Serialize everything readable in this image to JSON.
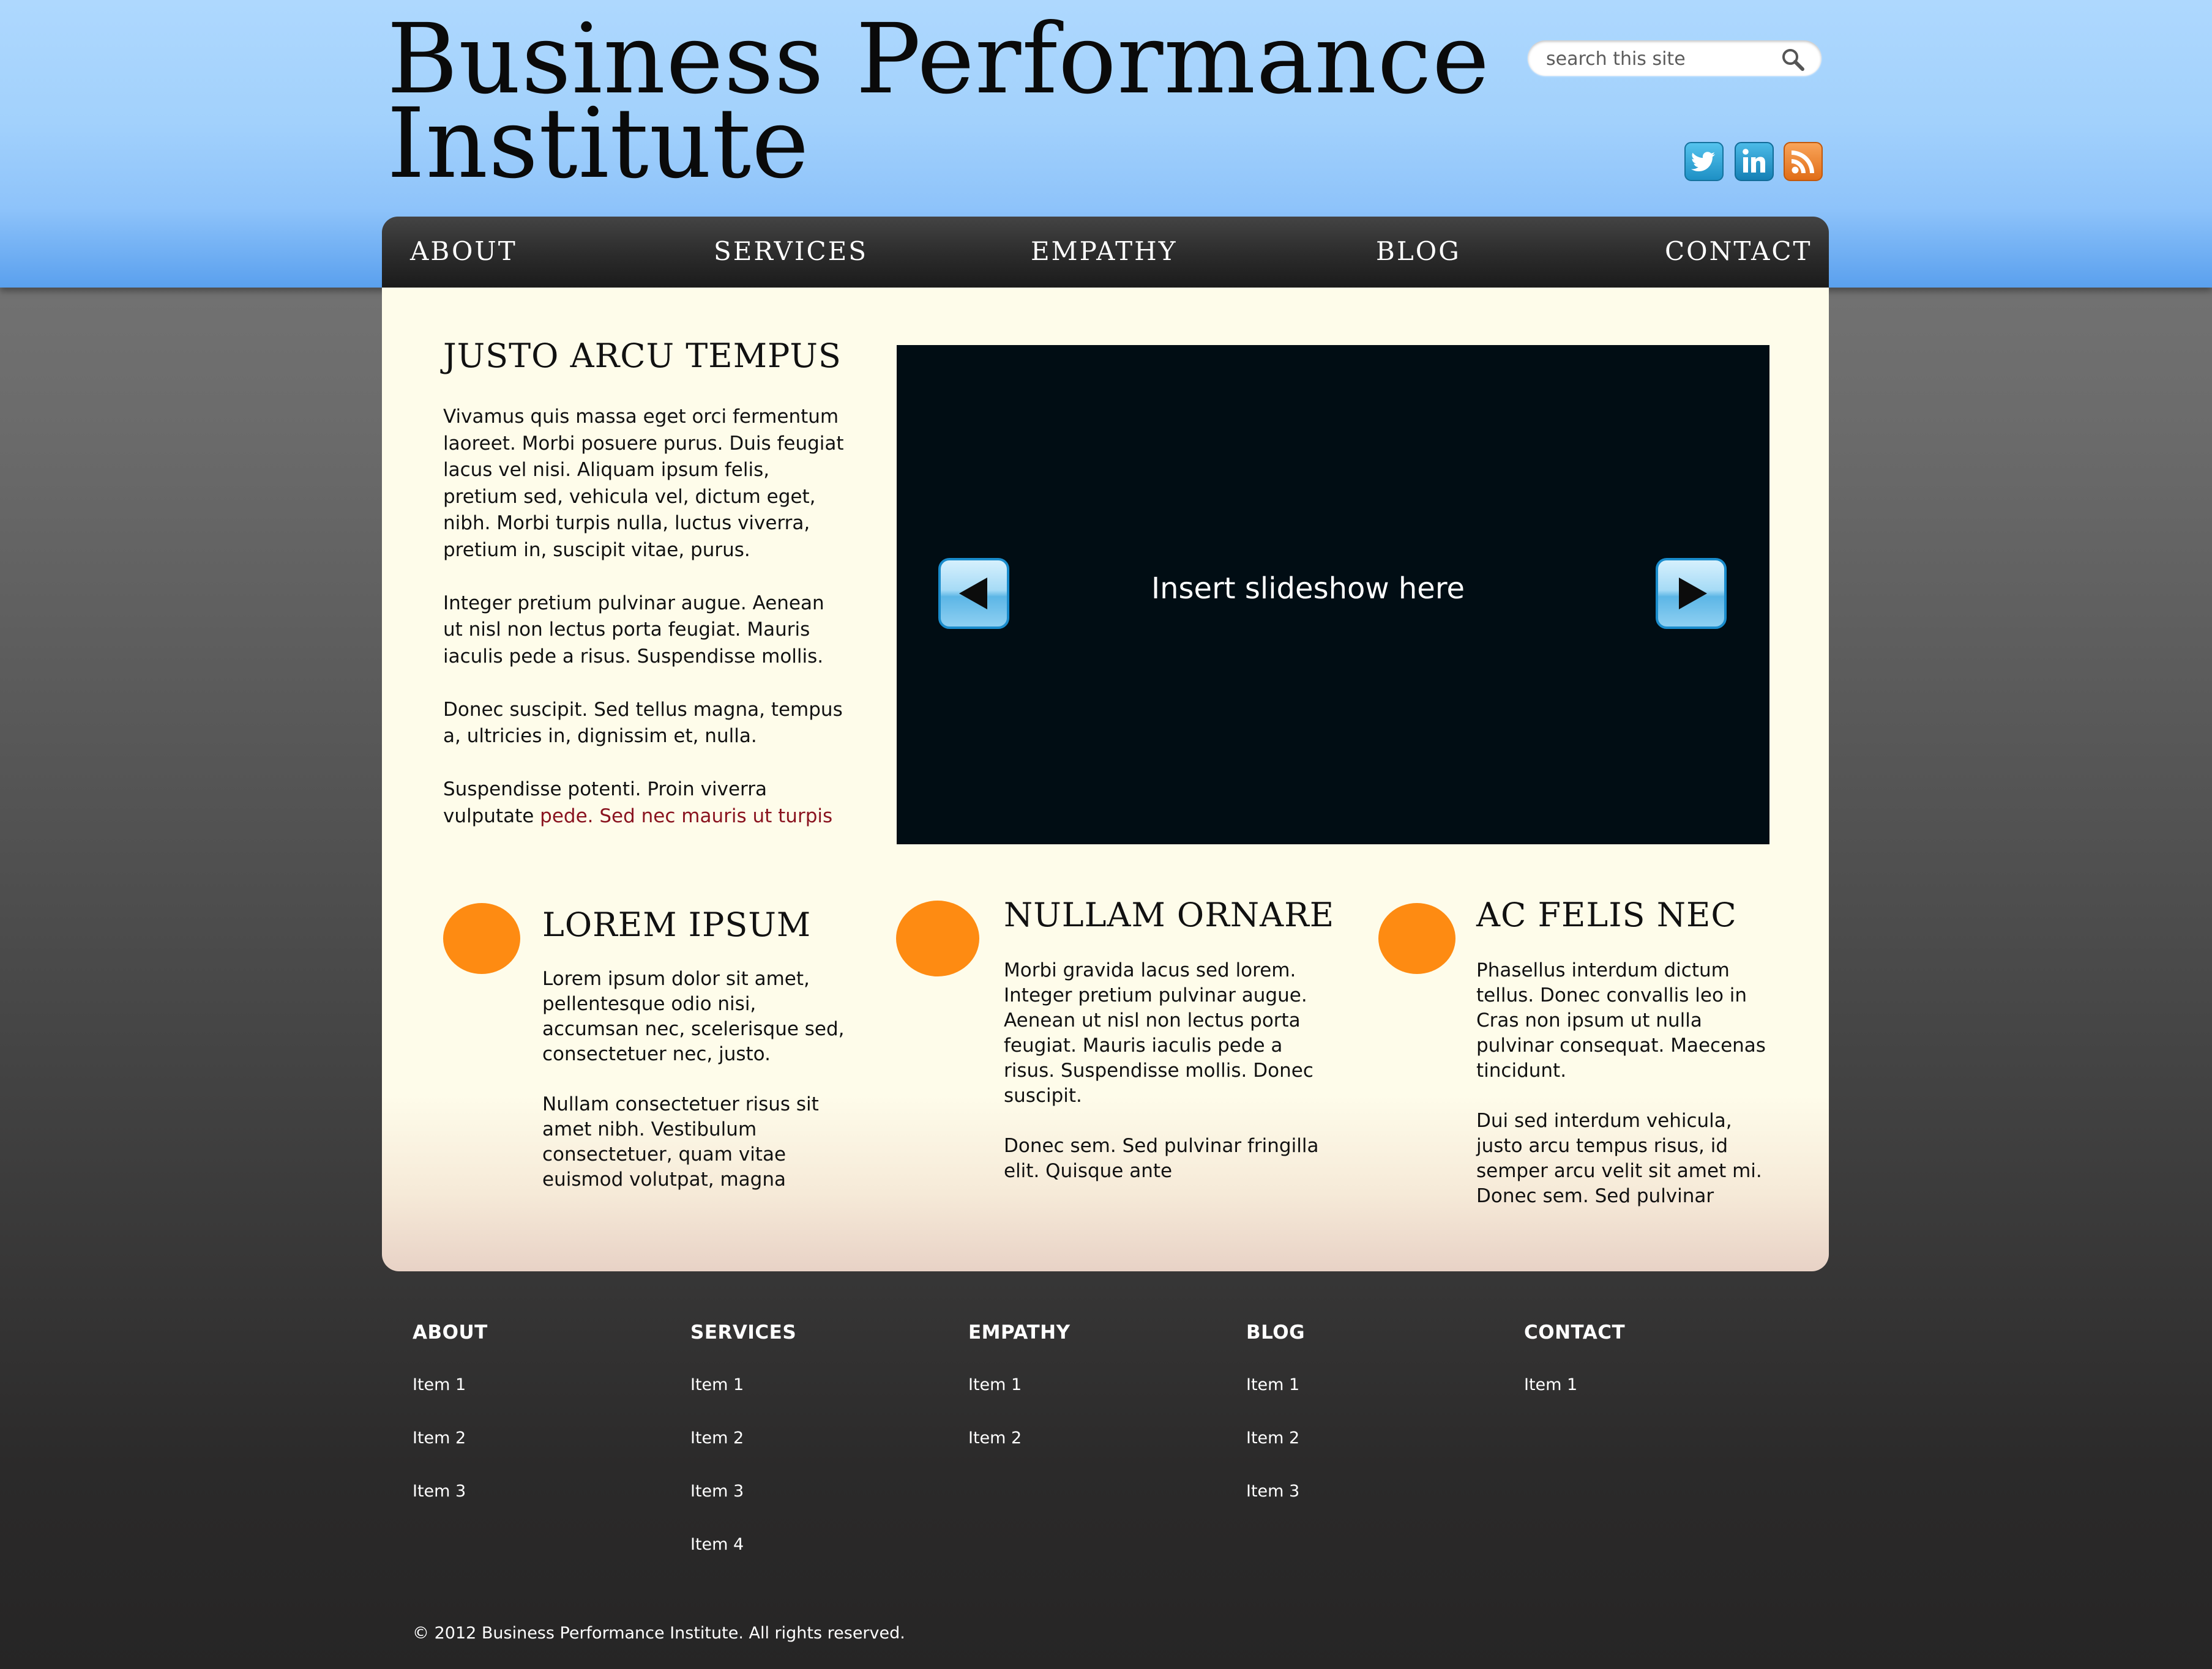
{
  "site": {
    "title_line1": "Business Performance",
    "title_line2": "Institute"
  },
  "search": {
    "placeholder": "search this site",
    "icon": "search-icon"
  },
  "social": [
    {
      "name": "twitter",
      "icon": "twitter-icon",
      "color": "#2aa5d8"
    },
    {
      "name": "linkedin",
      "icon": "linkedin-icon",
      "color": "#1b92c4"
    },
    {
      "name": "rss",
      "icon": "rss-icon",
      "color": "#ee7a24"
    }
  ],
  "nav": {
    "items": [
      {
        "label": "ABOUT"
      },
      {
        "label": "SERVICES"
      },
      {
        "label": "EMPATHY"
      },
      {
        "label": "BLOG"
      },
      {
        "label": "CONTACT"
      }
    ]
  },
  "intro": {
    "heading": "JUSTO ARCU TEMPUS",
    "p1": "Vivamus quis massa eget orci fermentum laoreet. Morbi posuere purus. Duis feugiat lacus vel nisi. Aliquam ipsum felis, pretium sed, vehicula vel, dictum eget, nibh. Morbi turpis nulla, luctus viverra, pretium in, suscipit vitae, purus.",
    "p2": "Integer pretium pulvinar augue. Aenean ut nisl non lectus porta feugiat. Mauris iaculis pede a risus. Suspendisse mollis.",
    "p3": "Donec suscipit. Sed tellus magna, tempus a, ultricies in, dignissim et, nulla.",
    "p4_text": "Suspendisse potenti. Proin viverra vulputate ",
    "p4_link": "pede. Sed nec mauris ut turpis",
    "link_color": "#8a1420"
  },
  "slideshow": {
    "caption": "Insert slideshow here",
    "prev_icon": "arrow-left-icon",
    "next_icon": "arrow-right-icon"
  },
  "features": [
    {
      "heading": "LOREM IPSUM",
      "p1": "Lorem ipsum dolor sit amet, pellentesque odio nisi, accumsan nec, scelerisque sed, consectetuer nec, justo.",
      "p2": "Nullam consectetuer risus sit amet nibh. Vestibulum consectetuer, quam vitae euismod volutpat, magna"
    },
    {
      "heading": "NULLAM ORNARE",
      "p1": "Morbi gravida lacus sed lorem. Integer pretium pulvinar augue. Aenean ut nisl non lectus porta feugiat. Mauris iaculis pede a risus. Suspendisse mollis. Donec suscipit.",
      "p2": "Donec sem. Sed pulvinar fringilla elit. Quisque ante"
    },
    {
      "heading": "AC FELIS NEC",
      "p1": "Phasellus interdum dictum tellus. Donec convallis leo in Cras non ipsum ut nulla pulvinar consequat. Maecenas tincidunt.",
      "p2": "Dui sed interdum vehicula, justo arcu tempus risus, id semper arcu velit sit amet mi. Donec sem. Sed pulvinar"
    }
  ],
  "accent_color": "#fe8b12",
  "footer": {
    "columns": [
      {
        "heading": "ABOUT",
        "items": [
          "Item 1",
          "Item 2",
          "Item 3"
        ]
      },
      {
        "heading": "SERVICES",
        "items": [
          "Item 1",
          "Item 2",
          "Item 3",
          "Item 4"
        ]
      },
      {
        "heading": "EMPATHY",
        "items": [
          "Item 1",
          "Item 2"
        ]
      },
      {
        "heading": "BLOG",
        "items": [
          "Item 1",
          "Item 2",
          "Item 3"
        ]
      },
      {
        "heading": "CONTACT",
        "items": [
          "Item 1"
        ]
      }
    ],
    "copyright": "© 2012 Business Performance Institute. All rights reserved."
  }
}
